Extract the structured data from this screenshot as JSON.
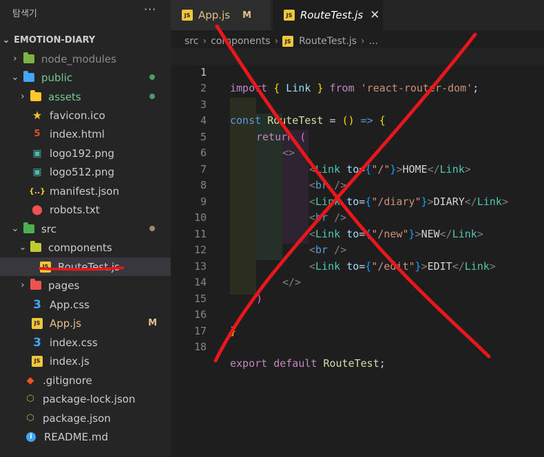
{
  "sidebar": {
    "title": "탐색기",
    "more": "···",
    "project": "EMOTION-DIARY",
    "items": [
      {
        "label": "node_modules",
        "color": "#8b8b8b"
      },
      {
        "label": "public",
        "color": "#73c991"
      },
      {
        "label": "assets",
        "color": "#73c991"
      },
      {
        "label": "favicon.ico"
      },
      {
        "label": "index.html"
      },
      {
        "label": "logo192.png"
      },
      {
        "label": "logo512.png"
      },
      {
        "label": "manifest.json"
      },
      {
        "label": "robots.txt"
      },
      {
        "label": "src"
      },
      {
        "label": "components"
      },
      {
        "label": "RouteTest.js"
      },
      {
        "label": "pages"
      },
      {
        "label": "App.css"
      },
      {
        "label": "App.js",
        "badge": "M",
        "color": "#e2c08d"
      },
      {
        "label": "index.css"
      },
      {
        "label": "index.js"
      },
      {
        "label": ".gitignore"
      },
      {
        "label": "package-lock.json"
      },
      {
        "label": "package.json"
      },
      {
        "label": "README.md"
      }
    ]
  },
  "tabs": [
    {
      "label": "App.js",
      "badge": "M"
    },
    {
      "label": "RouteTest.js",
      "close": "✕"
    }
  ],
  "breadcrumb": {
    "items": [
      "src",
      "components",
      "RouteTest.js",
      "..."
    ],
    "sep": "›"
  },
  "editor": {
    "line_numbers": [
      "1",
      "2",
      "3",
      "4",
      "5",
      "6",
      "7",
      "8",
      "9",
      "10",
      "11",
      "12",
      "13",
      "14",
      "15",
      "16",
      "17",
      "18"
    ],
    "lines": {
      "l1": [
        "import",
        "{",
        "Link",
        "}",
        "from",
        "'react-router-dom'",
        ";"
      ],
      "l3": [
        "const",
        "RouteTest",
        "=",
        "()",
        "=>",
        "{"
      ],
      "l4": [
        "return",
        "("
      ],
      "l5": [
        "<>"
      ],
      "l6": [
        "<",
        "Link",
        "to",
        "=",
        "{",
        "\"/\"",
        "}",
        ">",
        "HOME",
        "</",
        "Link",
        ">"
      ],
      "l7": [
        "<",
        "br",
        "/>"
      ],
      "l8": [
        "<",
        "Link",
        "to",
        "=",
        "{",
        "\"/diary\"",
        "}",
        ">",
        "DIARY",
        "</",
        "Link",
        ">"
      ],
      "l9": [
        "<",
        "br",
        "/>"
      ],
      "l10": [
        "<",
        "Link",
        "to",
        "=",
        "{",
        "\"/new\"",
        "}",
        ">",
        "NEW",
        "</",
        "Link",
        ">"
      ],
      "l11": [
        "<",
        "br",
        "/>"
      ],
      "l12": [
        "<",
        "Link",
        "to",
        "=",
        "{",
        "\"/edit\"",
        "}",
        ">",
        "EDIT",
        "</",
        "Link",
        ">"
      ],
      "l13": [
        "</>"
      ],
      "l14": [
        ")"
      ],
      "l16": [
        "}"
      ],
      "l18": [
        "export",
        "default",
        "RouteTest",
        ";"
      ]
    }
  },
  "colors": {
    "annotation_red": "#e8171b",
    "modified": "#e2c08d",
    "git_added": "#73c991"
  },
  "icons": {
    "js": "JS",
    "json": "{..}",
    "html": "5",
    "css": "3",
    "png": "▣",
    "robot": "⬤",
    "star": "★",
    "git": "◆",
    "node": "⬡",
    "info": "i"
  }
}
